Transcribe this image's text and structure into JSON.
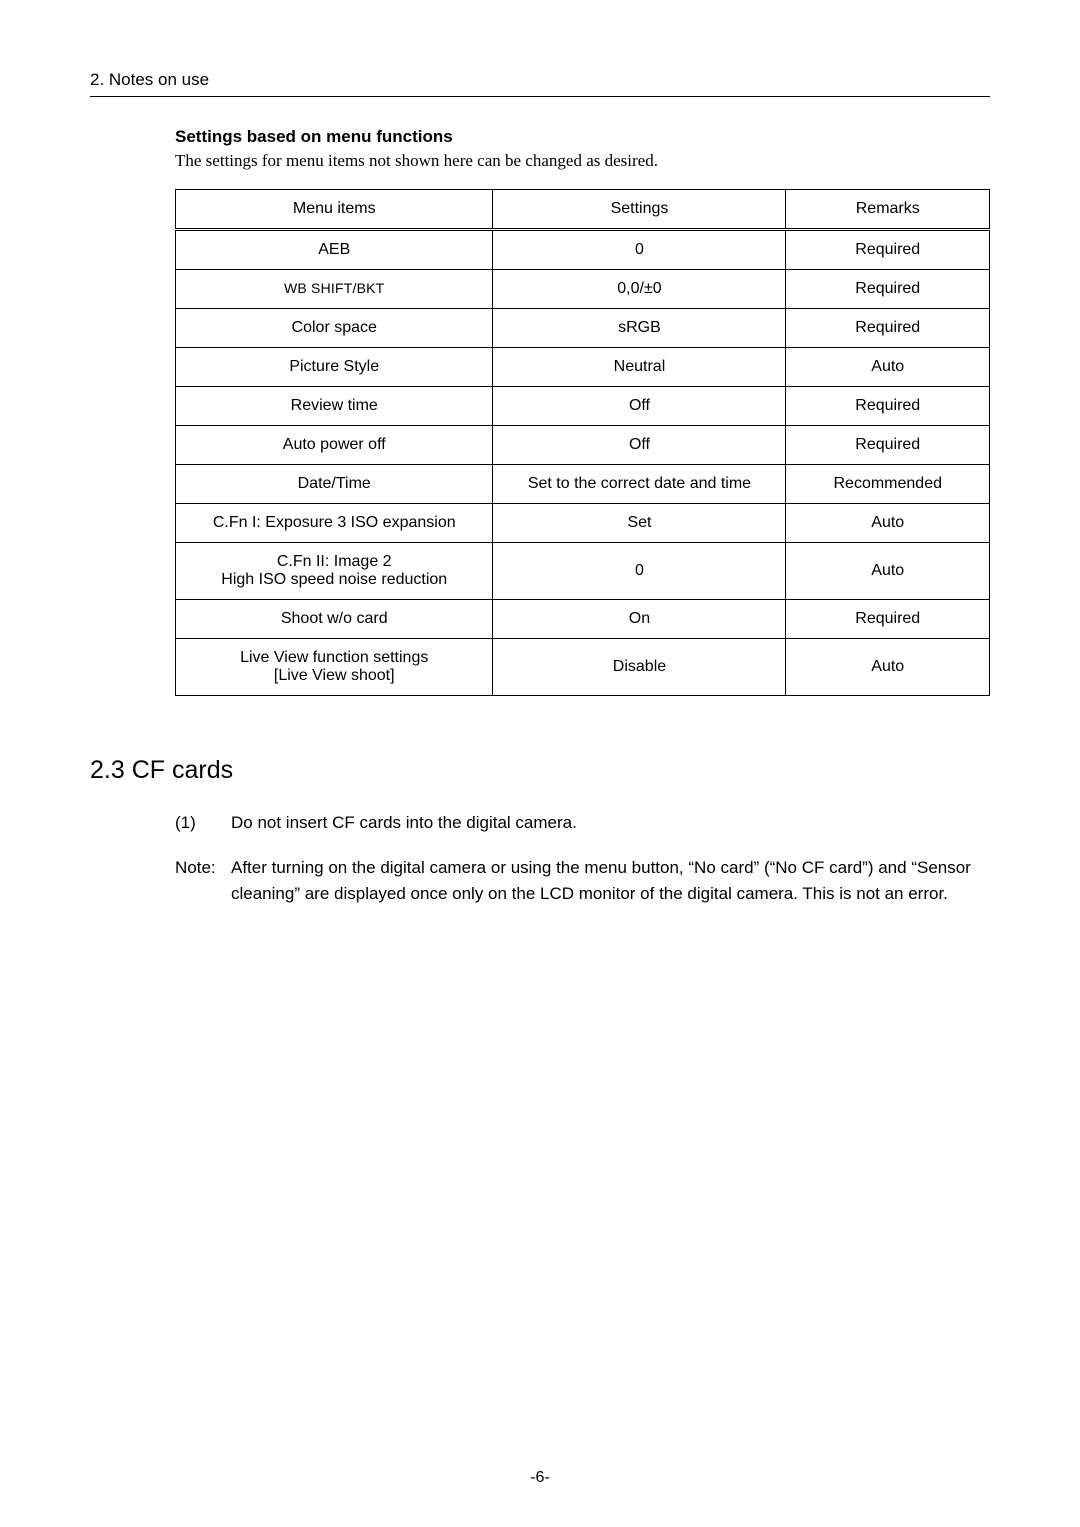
{
  "header": "2. Notes on use",
  "section": {
    "heading": "Settings based on menu functions",
    "desc": "The settings for menu items not shown here can be changed as desired."
  },
  "table": {
    "headers": {
      "c1": "Menu items",
      "c2": "Settings",
      "c3": "Remarks"
    },
    "rows": [
      {
        "c1": "AEB",
        "c2": "0",
        "c3": "Required"
      },
      {
        "c1": "WB SHIFT/BKT",
        "c2": "0,0/±0",
        "c3": "Required"
      },
      {
        "c1": "Color space",
        "c2": "sRGB",
        "c3": "Required"
      },
      {
        "c1": "Picture Style",
        "c2": "Neutral",
        "c3": "Auto"
      },
      {
        "c1": "Review time",
        "c2": "Off",
        "c3": "Required"
      },
      {
        "c1": "Auto power off",
        "c2": "Off",
        "c3": "Required"
      },
      {
        "c1": "Date/Time",
        "c2": "Set to the correct date and time",
        "c3": "Recommended"
      },
      {
        "c1": "C.Fn I: Exposure 3 ISO expansion",
        "c2": "Set",
        "c3": "Auto"
      },
      {
        "c1": "C.Fn II: Image 2\nHigh ISO speed noise reduction",
        "c2": "0",
        "c3": "Auto"
      },
      {
        "c1": "Shoot w/o card",
        "c2": "On",
        "c3": "Required"
      },
      {
        "c1": "Live View function settings\n[Live View shoot]",
        "c2": "Disable",
        "c3": "Auto"
      }
    ]
  },
  "subsection": {
    "title": "2.3 CF cards",
    "item_num": "(1)",
    "item_text": "Do not insert CF cards into the digital camera.",
    "note_label": "Note:",
    "note_text": "After turning on the digital camera or using the menu button, “No card” (“No CF card”) and “Sensor cleaning” are displayed once only on the LCD monitor of the digital camera. This is not an error."
  },
  "footer": "-6-"
}
